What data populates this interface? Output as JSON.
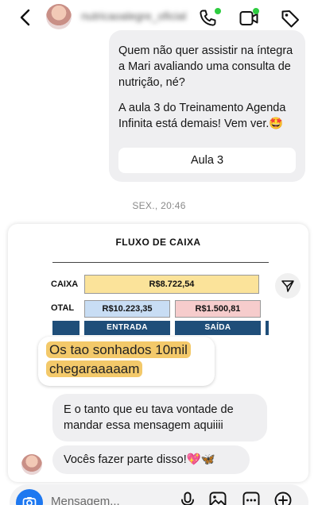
{
  "header": {
    "contact_name": "nutricaoalegre_oficial",
    "icons": [
      "back-arrow-icon",
      "phone-icon",
      "video-icon",
      "tag-icon"
    ],
    "online_color": "#2ecc40"
  },
  "thread": {
    "message_top": {
      "paragraph_1": "Quem não quer assistir na íntegra a Mari avaliando uma consulta de nutrição, né?",
      "paragraph_2": "A aula 3 do Treinamento Agenda Infinita está demais! Vem ver.🤩",
      "button_label": "Aula 3"
    },
    "timestamp": "SEX., 20:46",
    "card": {
      "title": "FLUXO DE CAIXA",
      "row_caixa_label": "CAIXA",
      "row_total_label": "OTAL",
      "caixa_value": "R$8.722,54",
      "entrada_value": "R$10.223,35",
      "saida_value": "R$1.500,81",
      "entrada_header": "ENTRADA",
      "saida_header": "SAÍDA",
      "sticker_line_1": "Os tao sonhados 10mil",
      "sticker_line_2": "chegaraaaaam"
    },
    "message_in_1": "E o tanto que eu tava vontade de mandar essa  mensagem aquiiii",
    "message_in_2": "Vocês fazer parte disso!💖🦋"
  },
  "composer": {
    "placeholder": "Mensagem...",
    "icons": [
      "camera-icon",
      "microphone-icon",
      "gallery-icon",
      "more-icon",
      "add-icon"
    ],
    "accent": "#1e78f0"
  }
}
